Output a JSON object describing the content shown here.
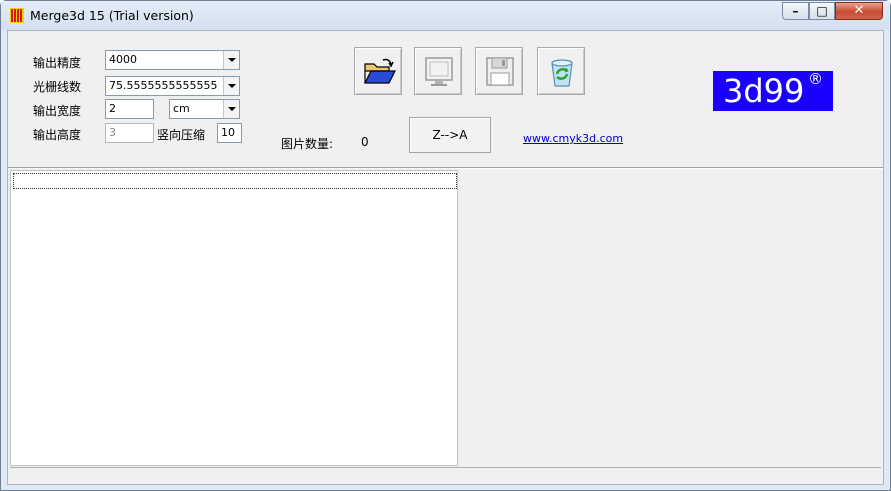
{
  "window": {
    "title": "Merge3d 15  (Trial version)",
    "controls": {
      "minimize": "–",
      "maximize": "□",
      "close": "✕"
    }
  },
  "settings": {
    "resolution_label": "输出精度",
    "resolution_value": "4000",
    "lpi_label": "光栅线数",
    "lpi_value": "75.5555555555555",
    "width_label": "输出宽度",
    "width_value": "2",
    "unit_value": "cm",
    "height_label": "输出高度",
    "height_value": "3",
    "compress_label": "竖向压缩",
    "compress_value": "10"
  },
  "toolbar": {
    "open_icon": "folder-open-icon",
    "preview_icon": "monitor-icon",
    "save_icon": "floppy-disk-icon",
    "recycle_icon": "recycle-bin-icon"
  },
  "info": {
    "image_count_label": "图片数量:",
    "image_count_value": "0",
    "sort_button": "Z-->A",
    "website": "www.cmyk3d.com"
  },
  "logo": {
    "text": "3d99",
    "reg": "®"
  },
  "colors": {
    "logo_bg": "#1a00ff",
    "link": "#0000cc"
  }
}
